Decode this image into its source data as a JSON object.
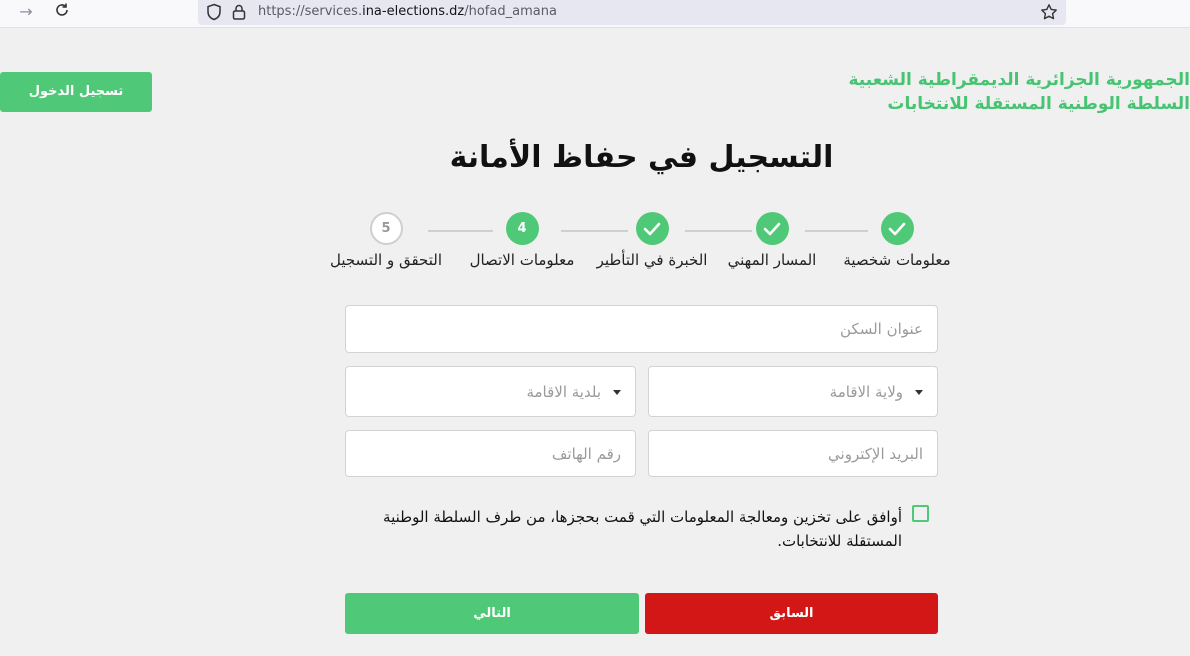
{
  "browser": {
    "url_prefix": "https://services.",
    "url_host": "ina-elections.dz",
    "url_path": "/hofad_amana"
  },
  "header": {
    "line1": "الجمهورية الجزائرية الديمقراطية الشعبية",
    "line2": "السلطة الوطنية المستقلة للانتخابات",
    "login_label": "تسجيل الدخول"
  },
  "page_title": "التسجيل في حفاظ الأمانة",
  "steps": [
    {
      "label": "معلومات شخصية",
      "status": "done"
    },
    {
      "label": "المسار المهني",
      "status": "done"
    },
    {
      "label": "الخبرة في التأطير",
      "status": "done"
    },
    {
      "label": "معلومات الاتصال",
      "status": "active",
      "number": "4"
    },
    {
      "label": "التحقق و التسجيل",
      "status": "pending",
      "number": "5"
    }
  ],
  "form": {
    "address_placeholder": "عنوان السكن",
    "wilaya_placeholder": "ولاية الاقامة",
    "commune_placeholder": "بلدية الاقامة",
    "email_placeholder": "البريد الإكتروني",
    "phone_placeholder": "رقم الهاتف",
    "consent_text": "أوافق على تخزين ومعالجة المعلومات التي قمت بحجزها، من طرف السلطة الوطنية المستقلة للانتخابات."
  },
  "buttons": {
    "next_label": "التالي",
    "prev_label": "السابق"
  },
  "colors": {
    "brand_green": "#4fc877",
    "danger_red": "#d31616"
  },
  "icons": [
    "arrow-right-icon",
    "reload-icon",
    "shield-icon",
    "lock-icon",
    "star-icon",
    "check-icon",
    "caret-down-icon"
  ]
}
